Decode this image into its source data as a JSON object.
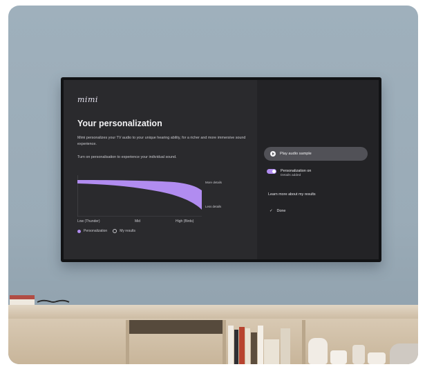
{
  "tv_screen": {
    "logo": "mimi",
    "title": "Your personalization",
    "description": "Mimi personalizes your TV audio to your unique hearing ability, for a richer and more immersive sound experience.",
    "instruction": "Turn on personalisation to experience your individual sound.",
    "chart_side_labels": {
      "top": "More details",
      "bottom": "Less details"
    },
    "x_labels": [
      "Low (Thunder)",
      "Mid",
      "High (Birds)"
    ],
    "legend": [
      {
        "label": "Personalization",
        "selected": true
      },
      {
        "label": "My results",
        "selected": false
      }
    ],
    "actions": {
      "play": "Play audio sample",
      "personalization_label": "Personalization on",
      "personalization_sub": "Details added",
      "personalization_on": true,
      "learn_more": "Learn more about my results",
      "done": "Done"
    },
    "colors": {
      "accent": "#b18cf0",
      "background": "#2a2a2d",
      "panel": "#232326"
    }
  }
}
